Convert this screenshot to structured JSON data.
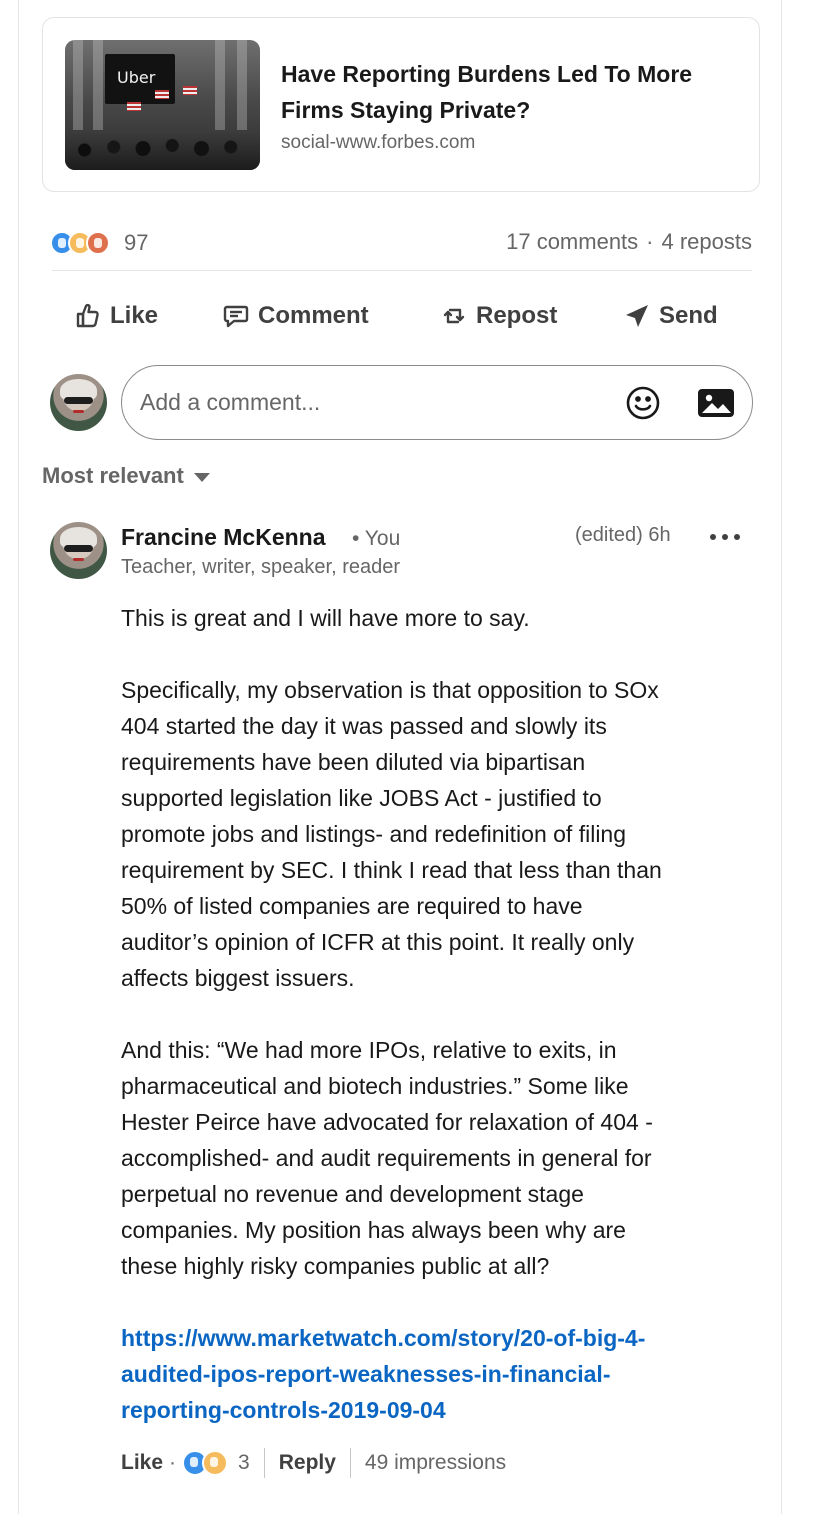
{
  "article": {
    "thumbnail_logo": "Uber",
    "title": "Have Reporting Burdens Led To More Firms Staying Private?",
    "source": "social-www.forbes.com"
  },
  "social": {
    "reaction_count": "97",
    "comments": "17 comments",
    "separator": "·",
    "reposts": "4 reposts"
  },
  "actions": {
    "like": "Like",
    "comment": "Comment",
    "repost": "Repost",
    "send": "Send"
  },
  "compose": {
    "placeholder": "Add a comment..."
  },
  "sort": {
    "label": "Most relevant"
  },
  "comment": {
    "author": "Francine McKenna",
    "you_badge": "• You",
    "headline": "Teacher, writer, speaker, reader",
    "meta": "(edited) 6h",
    "paragraphs": [
      [
        "This is great and I will have more to say."
      ],
      [
        "Specifically, my observation is that opposition to SOx",
        "404 started the day it was passed and slowly its",
        "requirements have been diluted via bipartisan",
        "supported legislation like JOBS Act - justified to",
        "promote jobs and listings- and redefinition of filing",
        "requirement by SEC. I think I read that less than than",
        "50% of listed companies are required to have",
        "auditor’s opinion of ICFR at this point. It really only",
        "affects biggest issuers."
      ],
      [
        "And this: “We had more IPOs, relative to exits, in",
        "pharmaceutical and biotech industries.” Some like",
        "Hester Peirce have advocated for relaxation of 404 -",
        "accomplished- and audit requirements in general for",
        "perpetual no revenue and development stage",
        "companies. My position has always been why are",
        "these highly risky companies public at all?"
      ]
    ],
    "link_lines": [
      "https://www.marketwatch.com/story/20-of-big-4-",
      "audited-ipos-report-weaknesses-in-financial-",
      "reporting-controls-2019-09-04"
    ],
    "footer": {
      "like": "Like",
      "dot": "·",
      "reaction_count": "3",
      "reply": "Reply",
      "impressions": "49 impressions"
    }
  },
  "colors": {
    "link": "#0a66c2",
    "muted_text": "#666666",
    "like_reaction": "#378fe9",
    "insight_reaction": "#f5bb5c",
    "love_reaction": "#df704d"
  }
}
